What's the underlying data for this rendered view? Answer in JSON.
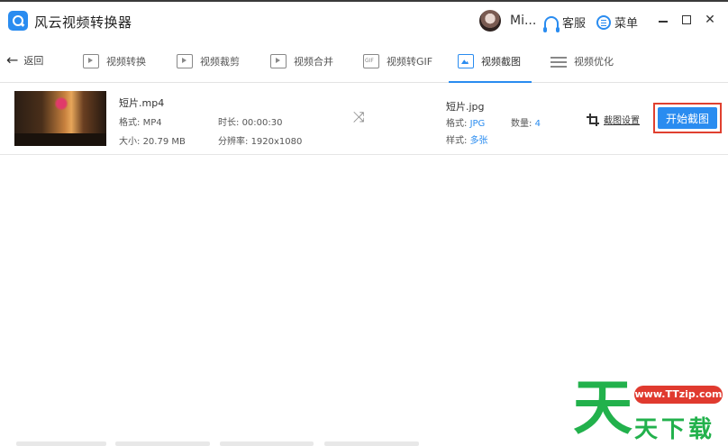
{
  "app": {
    "title": "风云视频转换器"
  },
  "header": {
    "username": "Mi...",
    "service_label": "客服",
    "menu_label": "菜单"
  },
  "nav": {
    "back_label": "返回",
    "tabs": [
      {
        "label": "视频转换",
        "icon": "video-convert-icon"
      },
      {
        "label": "视频裁剪",
        "icon": "video-crop-icon"
      },
      {
        "label": "视频合并",
        "icon": "video-merge-icon"
      },
      {
        "label": "视频转GIF",
        "icon": "gif-icon"
      },
      {
        "label": "视频截图",
        "icon": "screenshot-icon",
        "active": true
      },
      {
        "label": "视频优化",
        "icon": "optimize-icon"
      }
    ]
  },
  "file": {
    "source": {
      "name": "短片.mp4",
      "format_label": "格式:",
      "format": "MP4",
      "size_label": "大小:",
      "size": "20.79 MB",
      "duration_label": "时长:",
      "duration": "00:00:30",
      "resolution_label": "分辨率:",
      "resolution": "1920x1080"
    },
    "output": {
      "name": "短片.jpg",
      "format_label": "格式:",
      "format": "JPG",
      "count_label": "数量:",
      "count": "4",
      "style_label": "样式:",
      "style": "多张"
    },
    "crop_settings_label": "截图设置",
    "start_label": "开始截图"
  },
  "watermark": {
    "big": "天",
    "url": "www.TTzip.com",
    "text": "天下载"
  },
  "colors": {
    "accent": "#2a8cf0",
    "highlight_border": "#e0402f",
    "watermark_green": "#22b14c",
    "watermark_red": "#e03a2f"
  }
}
